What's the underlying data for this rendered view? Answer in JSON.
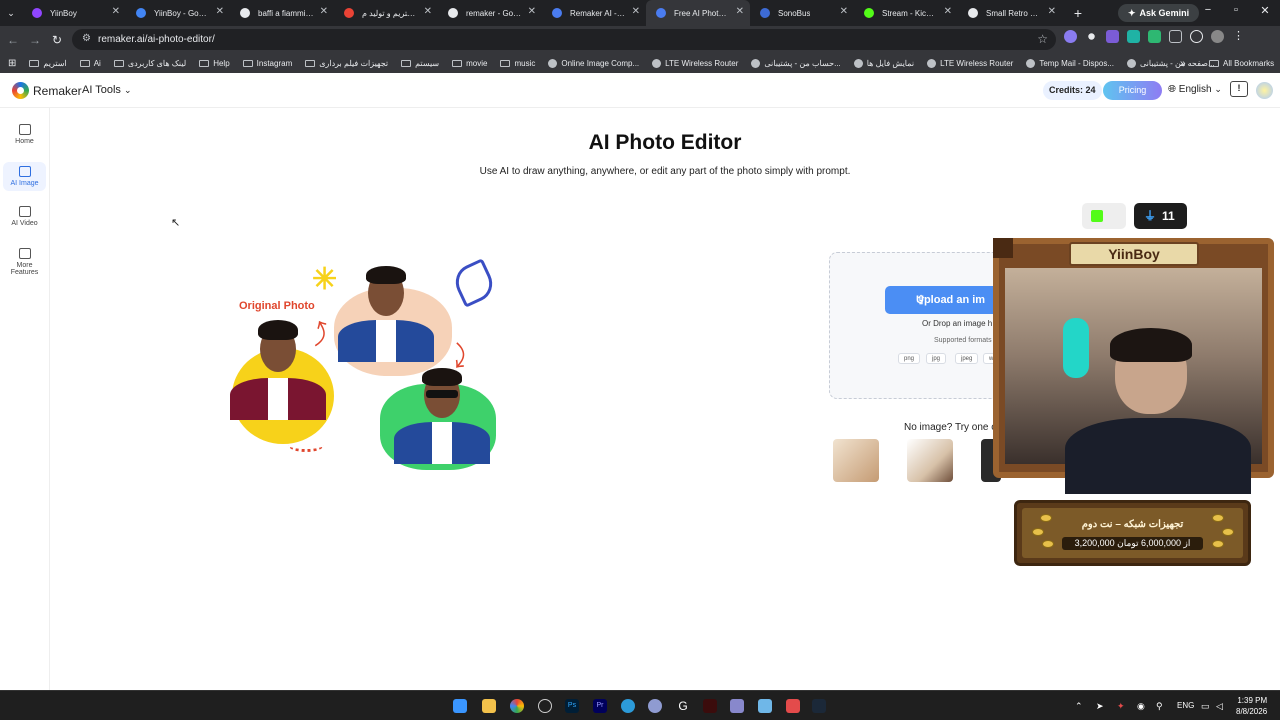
{
  "browser": {
    "tabs": [
      {
        "title": "YiinBoy",
        "color": "#9146ff",
        "active": false
      },
      {
        "title": "YiinBoy - Google",
        "color": "#4285f4",
        "active": false
      },
      {
        "title": "baffi a fiammifero",
        "color": "#e8eaed",
        "active": false
      },
      {
        "title": "استریم و تولید م...",
        "color": "#ea4335",
        "active": false
      },
      {
        "title": "remaker - Google",
        "color": "#e8eaed",
        "active": false
      },
      {
        "title": "Remaker AI - The",
        "color": "#4a7cf0",
        "active": false
      },
      {
        "title": "Free AI Photo Edit",
        "color": "#4a7cf0",
        "active": true
      },
      {
        "title": "SonoBus",
        "color": "#3d6bd6",
        "active": false
      },
      {
        "title": "Stream - Kick Das",
        "color": "#53fc18",
        "active": false
      },
      {
        "title": "Small Retro Lenn",
        "color": "#e8eaed",
        "active": false
      }
    ],
    "ask_gemini": "Ask Gemini",
    "url": "remaker.ai/ai-photo-editor/",
    "bookmarks": [
      {
        "label": "استریم",
        "icon": "folder-icon"
      },
      {
        "label": "Ai",
        "icon": "folder-icon"
      },
      {
        "label": "لینک های کاربردی",
        "icon": "folder-icon"
      },
      {
        "label": "Help",
        "icon": "folder-icon"
      },
      {
        "label": "Instagram",
        "icon": "folder-icon"
      },
      {
        "label": "تجهیزات فیلم برداری",
        "icon": "folder-icon"
      },
      {
        "label": "سیستم",
        "icon": "folder-icon"
      },
      {
        "label": "movie",
        "icon": "folder-icon"
      },
      {
        "label": "music",
        "icon": "folder-icon"
      },
      {
        "label": "Online Image Comp...",
        "icon": "cloud-icon"
      },
      {
        "label": "LTE Wireless Router",
        "icon": "globe-icon"
      },
      {
        "label": "حساب من - پشتیبانی...",
        "icon": "link-icon"
      },
      {
        "label": "نمایش فایل ها",
        "icon": "page-icon"
      },
      {
        "label": "LTE Wireless Router",
        "icon": "globe-icon"
      },
      {
        "label": "Temp Mail - Dispos...",
        "icon": "mail-icon"
      },
      {
        "label": "صفحه من - پشتیبانی...",
        "icon": "link-icon"
      }
    ],
    "all_bookmarks": "All Bookmarks"
  },
  "app": {
    "brand": "Remaker",
    "ai_tools": "AI Tools",
    "credits": "Credits: 24",
    "pricing": "Pricing",
    "language": "English",
    "sidebar": [
      {
        "label": "Home",
        "icon": "home-icon",
        "active": false
      },
      {
        "label": "AI Image",
        "icon": "image-icon",
        "active": true
      },
      {
        "label": "AI Video",
        "icon": "video-icon",
        "active": false
      },
      {
        "label": "More\nFeatures",
        "icon": "grid-icon",
        "active": false
      }
    ],
    "title": "AI Photo Editor",
    "subtitle": "Use AI to draw anything, anywhere, or edit any part of the photo simply with prompt.",
    "hero_label": "Original Photo",
    "upload": {
      "button": "Upload an im",
      "drop_text": "Or Drop an image h",
      "formats_text": "Supported formats",
      "formats": [
        "png",
        "jpg",
        "jpeg",
        "we"
      ]
    },
    "try_text": "No image? Try one of"
  },
  "stream_overlay": {
    "name": "YiinBoy",
    "viewers": "11",
    "goal_title": "تجهیزات شبکه – نت دوم",
    "goal_progress": "3,200,000 از 6,000,000 تومان"
  },
  "taskbar": {
    "lang": "ENG",
    "time": "1:39 PM",
    "date": "8/8/2026"
  },
  "colors": {
    "accent": "#4b8ef4",
    "pricing_gradient": [
      "#5fc4f0",
      "#8e7cf3"
    ],
    "browser_dark": "#202124"
  }
}
